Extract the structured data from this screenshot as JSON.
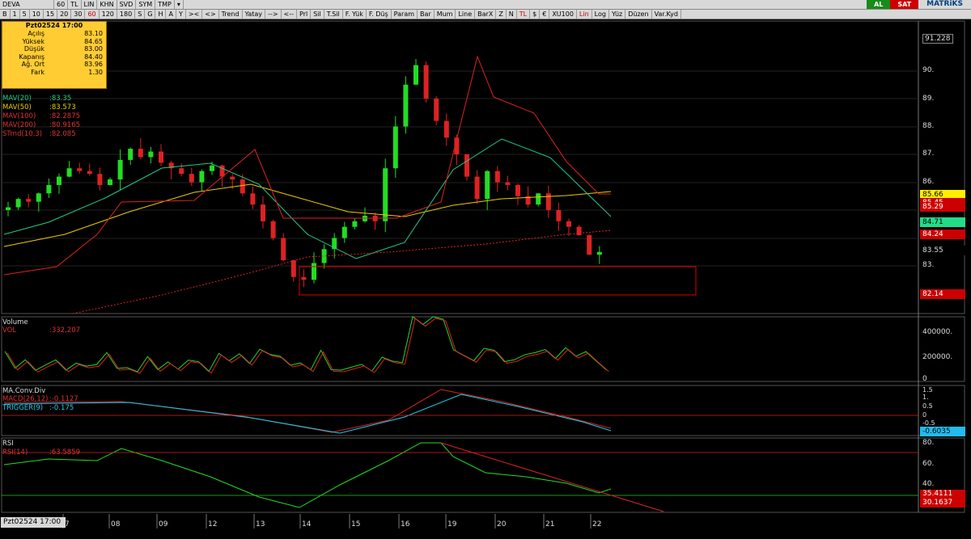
{
  "toolbar1": {
    "items": [
      "DEVA",
      "60",
      "TL",
      "LIN",
      "KHN",
      "SVD",
      "SYM",
      "TMP",
      "▾"
    ],
    "right": {
      "buy": "AL",
      "sell": "SAT",
      "brand": "MATRiKS"
    }
  },
  "toolbar2": {
    "items": [
      "B",
      "1",
      "5",
      "10",
      "15",
      "20",
      "30",
      "60",
      "120",
      "180",
      "S",
      "G",
      "H",
      "A",
      "Y",
      "><",
      "<>",
      "Trend",
      "Yatay",
      "-->",
      "<--",
      "Prl",
      "Sil",
      "T.Sil",
      "F. Yük",
      "F. Düş",
      "Param",
      "Bar",
      "Mum",
      "Line",
      "BarX",
      "Z",
      "N",
      "TL",
      "$",
      "€",
      "XU100",
      "Lin",
      "Log",
      "Yüz",
      "Düzen",
      "Var.Kyd"
    ]
  },
  "infobox": {
    "title": "Pzt02524 17:00",
    "rows": [
      {
        "k": "Açılış",
        "v": "83.10"
      },
      {
        "k": "Yüksek",
        "v": "84.65"
      },
      {
        "k": "Düşük",
        "v": "83.00"
      },
      {
        "k": "Kapanış",
        "v": "84.40"
      },
      {
        "k": "Ağ. Ort",
        "v": "83.96"
      },
      {
        "k": "Fark",
        "v": "1.30"
      }
    ]
  },
  "legend": [
    {
      "n": "MAV(20)",
      "v": ":83.35",
      "color": "#22cc88"
    },
    {
      "n": "MAV(50)",
      "v": ":83.573",
      "color": "#eecc00"
    },
    {
      "n": "MAV(100)",
      "v": ":82.2875",
      "color": "#dd3333"
    },
    {
      "n": "MAV(200)",
      "v": ":80.9165",
      "color": "#dd3333"
    },
    {
      "n": "STrnd(10,3)",
      "v": ":82.085",
      "color": "#dd3333"
    }
  ],
  "price_axis": [
    "91.228",
    "90.",
    "89.",
    "88.",
    "87.",
    "86.",
    "85.",
    "84.",
    "83."
  ],
  "price_flags": [
    {
      "v": "85.66",
      "bg": "#ffee00",
      "fg": "#000"
    },
    {
      "v": "85.45",
      "bg": "#cc0000",
      "fg": "#fff"
    },
    {
      "v": "85.29",
      "bg": "#cc0000",
      "fg": "#fff"
    },
    {
      "v": "84.71",
      "bg": "#22dd88",
      "fg": "#000"
    },
    {
      "v": "84.24",
      "bg": "#cc0000",
      "fg": "#fff"
    },
    {
      "v": "83.55",
      "bg": "#000",
      "fg": "#ddd"
    },
    {
      "v": "82.14",
      "bg": "#cc0000",
      "fg": "#fff"
    }
  ],
  "volume": {
    "title": "Volume",
    "label": "VOL",
    "value": ":332,207",
    "axis": [
      "400000.",
      "200000.",
      "0"
    ]
  },
  "macd": {
    "title": "MA.Conv.Div",
    "macd_label": "MACD(26,12)",
    "macd_value": ":-0.1127",
    "trig_label": "TRIGGER(9)",
    "trig_value": ":-0.175",
    "axis": [
      "1.5",
      "1.",
      "0.5",
      "0",
      "-0.5"
    ],
    "flag": "-0.6035"
  },
  "rsi": {
    "title": "RSI",
    "label": "RSI(14)",
    "value": ":63.5859",
    "axis": [
      "80.",
      "60.",
      "40."
    ],
    "flag1": "35.4111",
    "flag2": "30.1637"
  },
  "dates": [
    "7",
    "08",
    "09",
    "12",
    "13",
    "14",
    "15",
    "16",
    "19",
    "20",
    "21",
    "22"
  ],
  "status": "Pzt02524 17:00",
  "chart_data": {
    "type": "line",
    "series": [
      {
        "name": "MAV(20)",
        "values": [
          83.35
        ]
      },
      {
        "name": "MAV(50)",
        "values": [
          83.573
        ]
      },
      {
        "name": "MAV(100)",
        "values": [
          82.2875
        ]
      },
      {
        "name": "MAV(200)",
        "values": [
          80.9165
        ]
      },
      {
        "name": "STrnd(10,3)",
        "values": [
          82.085
        ]
      }
    ]
  }
}
